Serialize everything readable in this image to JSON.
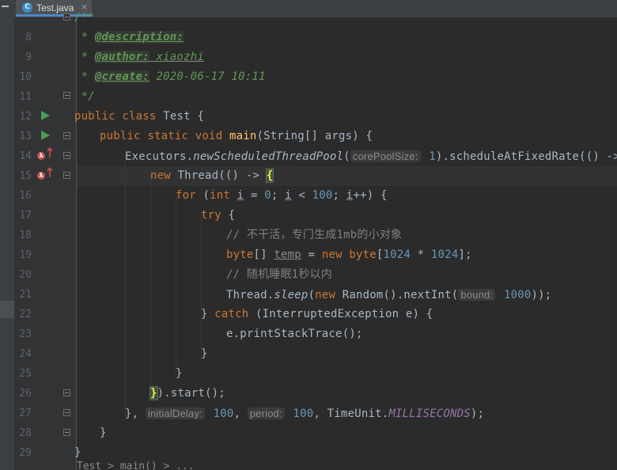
{
  "tab": {
    "title": "Test.java",
    "icon": "class-icon",
    "close": "×"
  },
  "lines": [
    {
      "n": "8"
    },
    {
      "n": "9"
    },
    {
      "n": "10"
    },
    {
      "n": "11"
    },
    {
      "n": "12"
    },
    {
      "n": "13"
    },
    {
      "n": "14"
    },
    {
      "n": "15"
    },
    {
      "n": "16"
    },
    {
      "n": "17"
    },
    {
      "n": "18"
    },
    {
      "n": "19"
    },
    {
      "n": "20"
    },
    {
      "n": "21"
    },
    {
      "n": "22"
    },
    {
      "n": "23"
    },
    {
      "n": "24"
    },
    {
      "n": "25"
    },
    {
      "n": "26"
    },
    {
      "n": "27"
    },
    {
      "n": "28"
    },
    {
      "n": "29"
    }
  ],
  "code": {
    "l7": "/**",
    "l8": {
      "star": " * ",
      "tag": "@description:"
    },
    "l9": {
      "star": " * ",
      "tag": "@author:",
      "val": " xiaozhi"
    },
    "l10": {
      "star": " * ",
      "tag": "@create:",
      "val": " 2020-06-17 10:11"
    },
    "l11": " */",
    "l12": {
      "kw": "public class ",
      "name": "Test {"
    },
    "l13": {
      "kw": "public static void ",
      "fn": "main",
      "rest": "(String[] args) {"
    },
    "l14": {
      "a": "Executors.",
      "b": "newScheduledThreadPool",
      "c": "(",
      "hint": "corePoolSize:",
      "num": " 1",
      "d": ").scheduleAtFixedRate(() -> {"
    },
    "l15": {
      "kw": "new ",
      "a": "Thread(() -> ",
      "brace": "{"
    },
    "l16": {
      "kw1": "for ",
      "a": "(",
      "kw2": "int ",
      "i": "i",
      "b": " = ",
      "n0": "0",
      "c": "; ",
      "i2": "i",
      "d": " < ",
      "n1": "100",
      "e": "; ",
      "i3": "i",
      "f": "++) {"
    },
    "l17": {
      "kw": "try ",
      "a": "{"
    },
    "l18": "// 不干活，专门生成1mb的小对象",
    "l19": {
      "kw": "byte",
      "a": "[] ",
      "v": "temp",
      "b": " = ",
      "kw2": "new byte",
      "c": "[",
      "n1": "1024",
      "d": " * ",
      "n2": "1024",
      "e": "];"
    },
    "l20": "// 随机睡眠1秒以内",
    "l21": {
      "a": "Thread.",
      "st": "sleep",
      "b": "(",
      "kw": "new ",
      "c": "Random().nextInt(",
      "hint": "bound:",
      "n": " 1000",
      "d": "));"
    },
    "l22": {
      "a": "} ",
      "kw": "catch ",
      "b": "(InterruptedException e) {"
    },
    "l23": {
      "a": "e.printStackTrace();"
    },
    "l24": "}",
    "l25": "}",
    "l26": {
      "brace": "}",
      "a": ").start();"
    },
    "l27": {
      "a": "}, ",
      "hint1": "initialDelay:",
      "n1": " 100",
      "b": ", ",
      "hint2": "period:",
      "n2": " 100",
      "c": ", TimeUnit.",
      "fld": "MILLISECONDS",
      "d": ");"
    },
    "l28": "}",
    "l29": "}"
  },
  "breadcrumb": "Test > main() > ...",
  "colors": {
    "keyword": "#cc7832",
    "comment": "#629755",
    "number": "#6897bb",
    "function": "#ffc66d",
    "field": "#9876aa",
    "text": "#a9b7c6"
  }
}
